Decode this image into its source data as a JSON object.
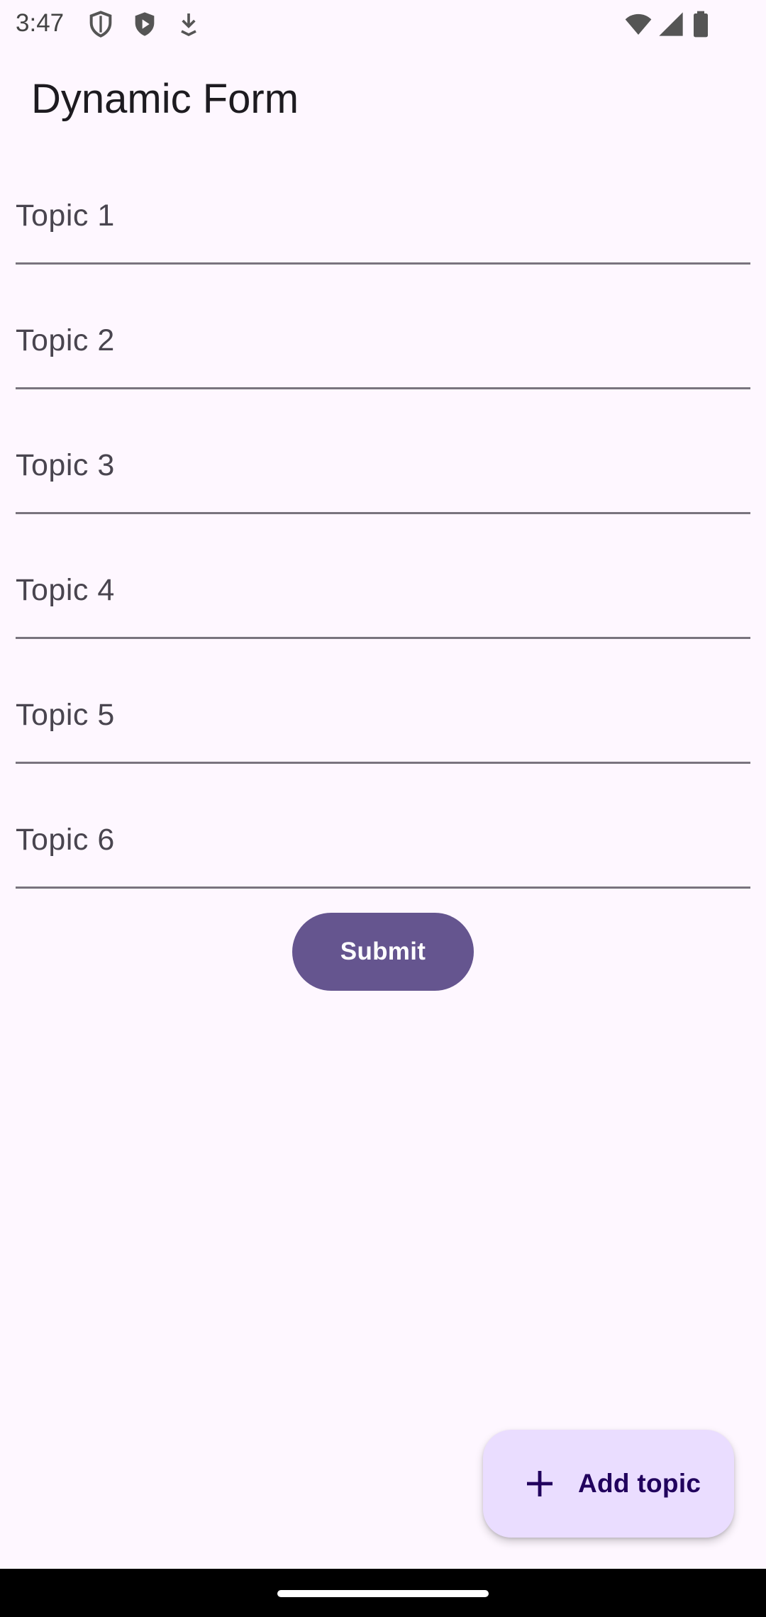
{
  "status_bar": {
    "time": "3:47",
    "icons_left": [
      "shield-outline-icon",
      "shield-play-icon",
      "download-arrow-icon"
    ],
    "icons_right": [
      "wifi-icon",
      "signal-icon",
      "battery-icon"
    ]
  },
  "app_bar": {
    "title": "Dynamic Form"
  },
  "form": {
    "topics": [
      {
        "label": "Topic 1"
      },
      {
        "label": "Topic 2"
      },
      {
        "label": "Topic 3"
      },
      {
        "label": "Topic 4"
      },
      {
        "label": "Topic 5"
      },
      {
        "label": "Topic 6"
      }
    ],
    "submit_label": "Submit"
  },
  "fab": {
    "label": "Add topic",
    "icon": "plus-icon"
  },
  "colors": {
    "background": "#FEF7FF",
    "primary": "#65558F",
    "fab_container": "#EADDFF",
    "on_fab": "#21005D",
    "outline": "#79747E"
  }
}
